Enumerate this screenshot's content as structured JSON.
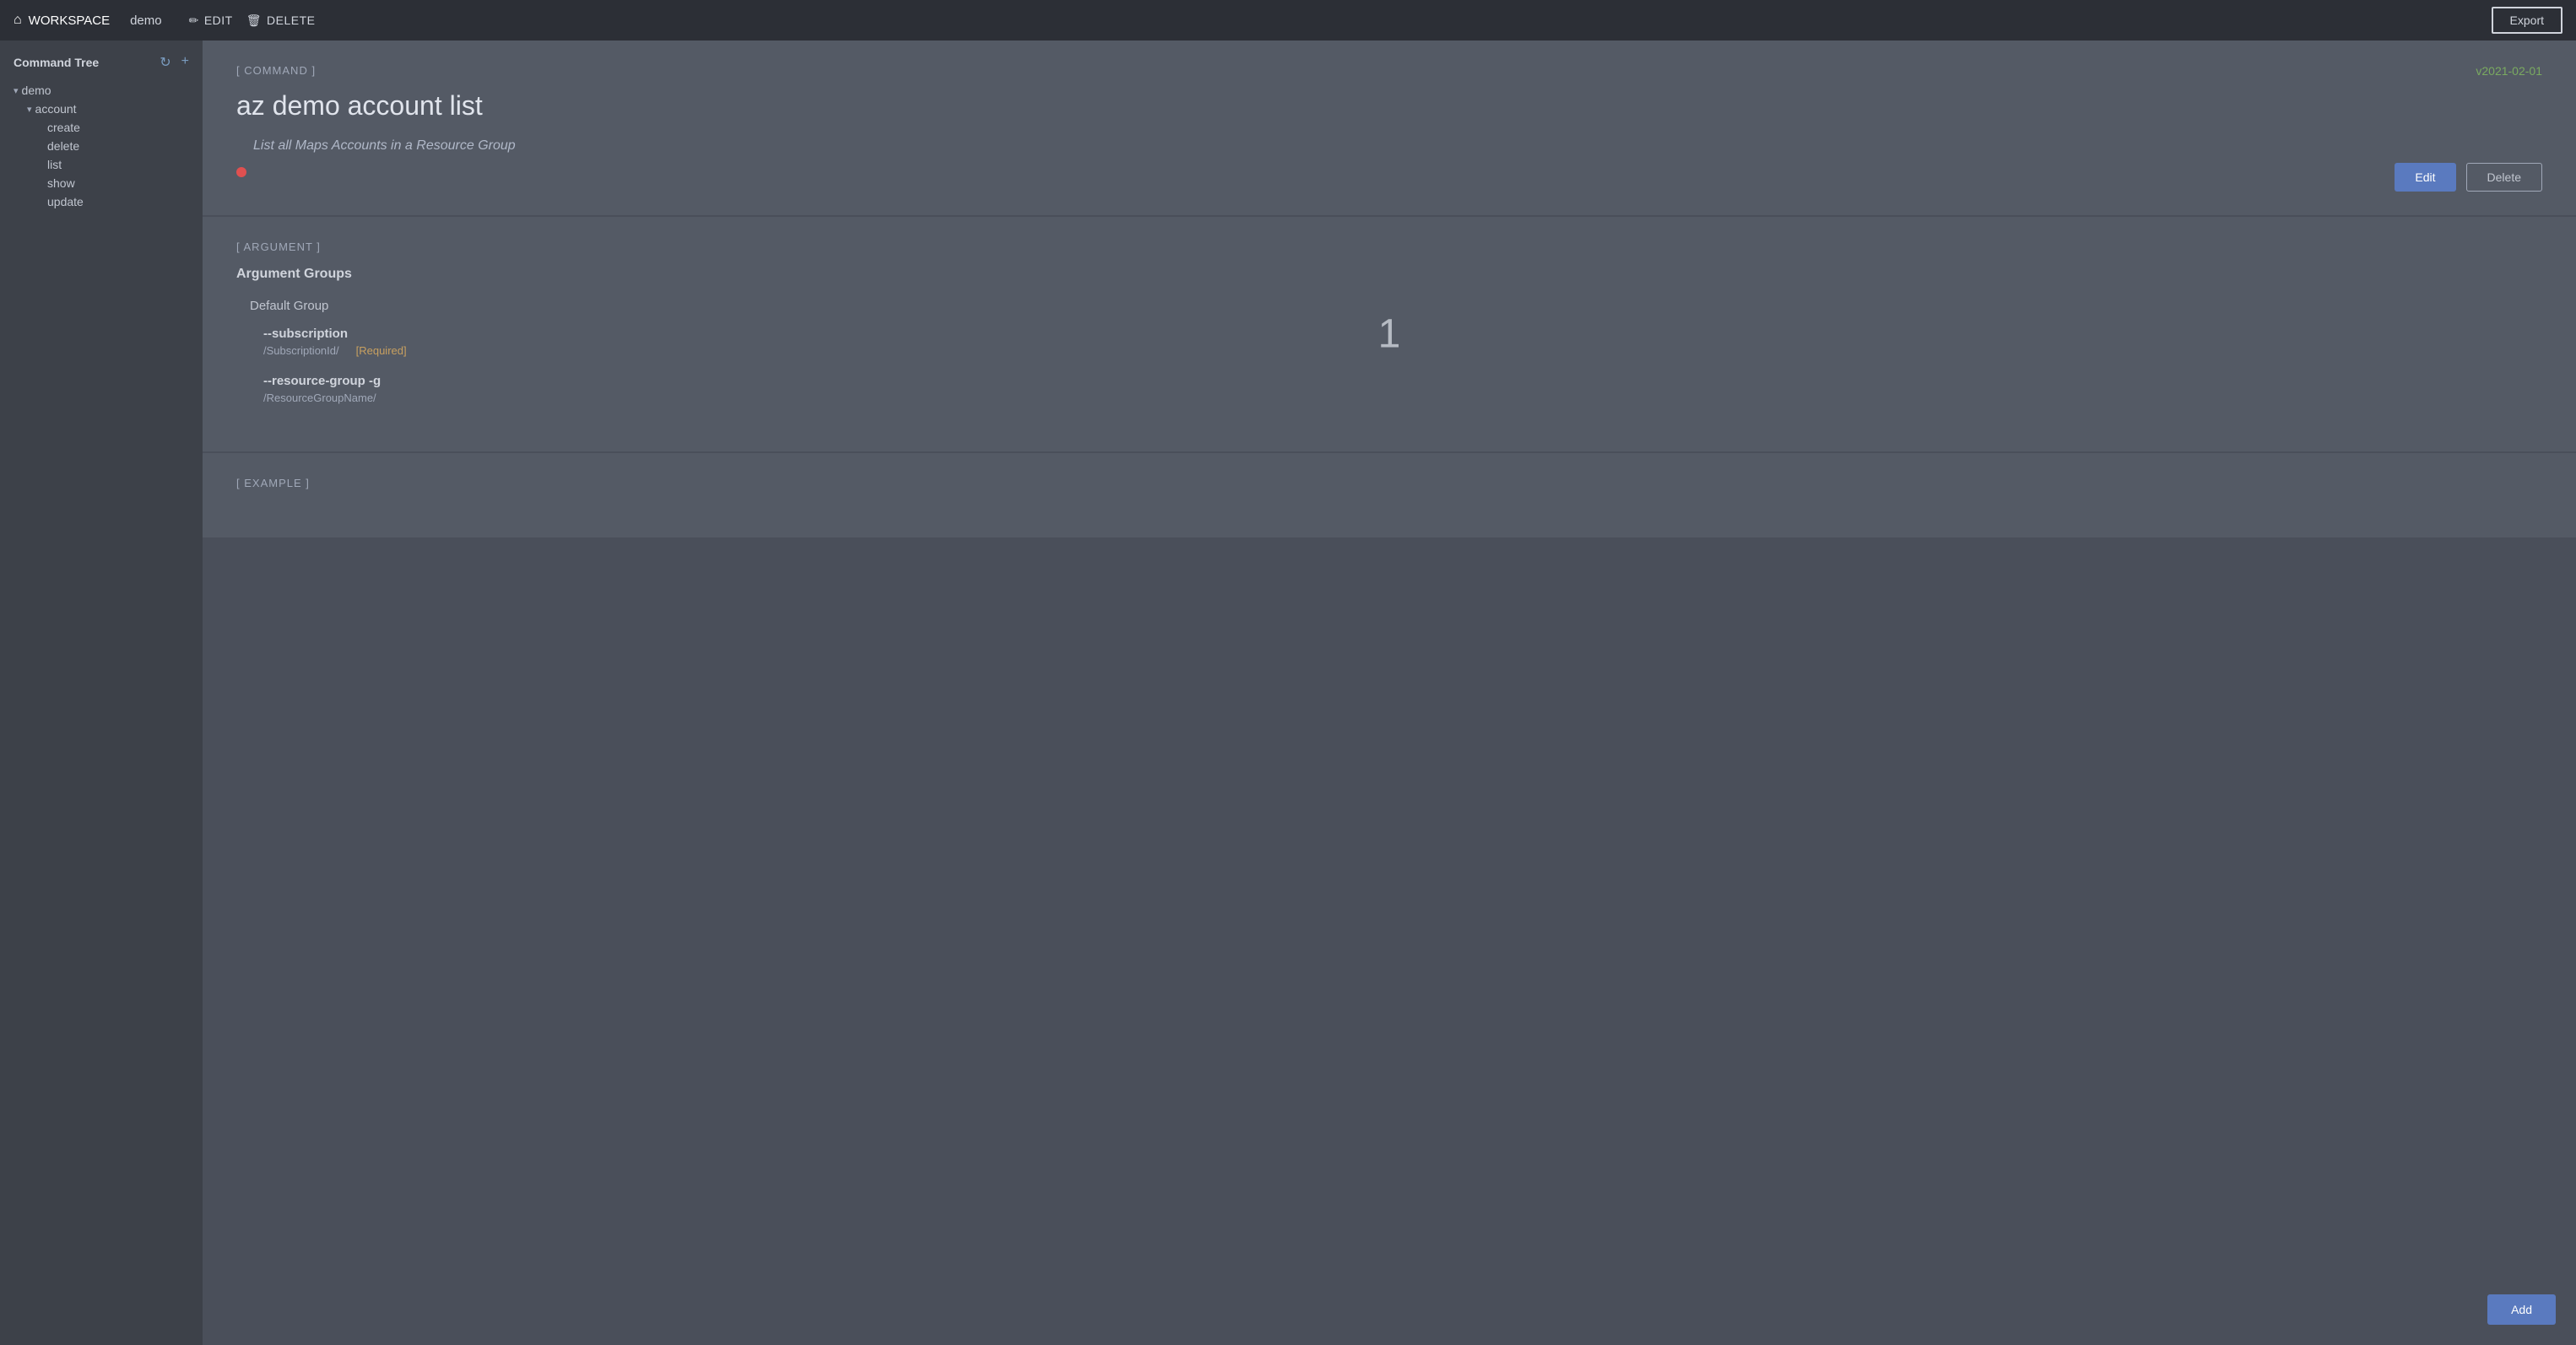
{
  "topNav": {
    "brand": "WORKSPACE",
    "demo": "demo",
    "edit_label": "EDIT",
    "delete_label": "DELETE",
    "export_label": "Export"
  },
  "sidebar": {
    "title": "Command Tree",
    "items": [
      {
        "id": "demo",
        "label": "demo",
        "level": 0,
        "chevron": "▾",
        "expanded": true
      },
      {
        "id": "account",
        "label": "account",
        "level": 1,
        "chevron": "▾",
        "expanded": true
      },
      {
        "id": "create",
        "label": "create",
        "level": 2
      },
      {
        "id": "delete",
        "label": "delete",
        "level": 2
      },
      {
        "id": "list",
        "label": "list",
        "level": 2
      },
      {
        "id": "show",
        "label": "show",
        "level": 2
      },
      {
        "id": "update",
        "label": "update",
        "level": 2
      }
    ]
  },
  "commandSection": {
    "tag": "[ COMMAND ]",
    "version": "v2021-02-01",
    "title": "az demo account list",
    "description": "List all Maps Accounts in a Resource Group",
    "edit_label": "Edit",
    "delete_label": "Delete"
  },
  "argumentSection": {
    "tag": "[ ARGUMENT ]",
    "number": "1",
    "groups_title": "Argument Groups",
    "default_group": "Default Group",
    "arguments": [
      {
        "name": "--subscription",
        "path": "/SubscriptionId/",
        "required": "[Required]"
      },
      {
        "name": "--resource-group -g",
        "path": "/ResourceGroupName/",
        "required": ""
      }
    ]
  },
  "exampleSection": {
    "tag": "[ EXAMPLE ]",
    "add_label": "Add"
  },
  "icons": {
    "home": "⌂",
    "pencil": "✏",
    "trash": "🗑",
    "refresh": "↻",
    "plus": "+"
  }
}
